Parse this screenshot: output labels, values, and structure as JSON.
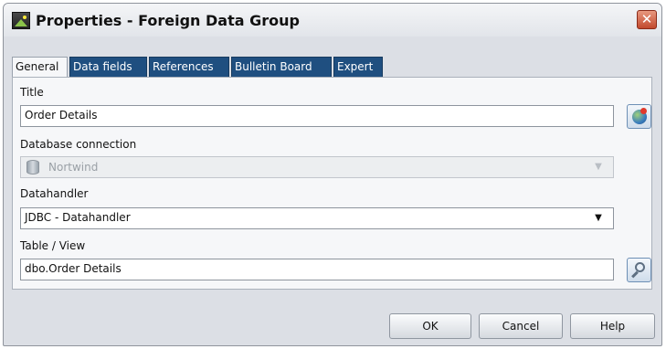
{
  "window": {
    "title": "Properties - Foreign Data Group",
    "close_glyph": "✕"
  },
  "tabs": [
    {
      "label": "General",
      "active": true
    },
    {
      "label": "Data fields",
      "active": false
    },
    {
      "label": "References",
      "active": false
    },
    {
      "label": "Bulletin Board",
      "active": false
    },
    {
      "label": "Expert",
      "active": false
    }
  ],
  "form": {
    "title_label": "Title",
    "title_value": "Order Details",
    "dbconn_label": "Database connection",
    "dbconn_value": "Nortwind",
    "datahandler_label": "Datahandler",
    "datahandler_value": "JDBC - Datahandler",
    "table_label": "Table / View",
    "table_value": "dbo.Order Details"
  },
  "buttons": {
    "ok": "OK",
    "cancel": "Cancel",
    "help": "Help"
  },
  "icons": {
    "window": "app-picture-icon",
    "globe": "globe-icon",
    "database": "database-icon",
    "search": "magnifier-icon",
    "dropdown": "chevron-down-icon"
  },
  "colors": {
    "tab_inactive": "#1f4f80",
    "dialog_bg": "#dcdfe5",
    "close_button": "#c2492d"
  }
}
